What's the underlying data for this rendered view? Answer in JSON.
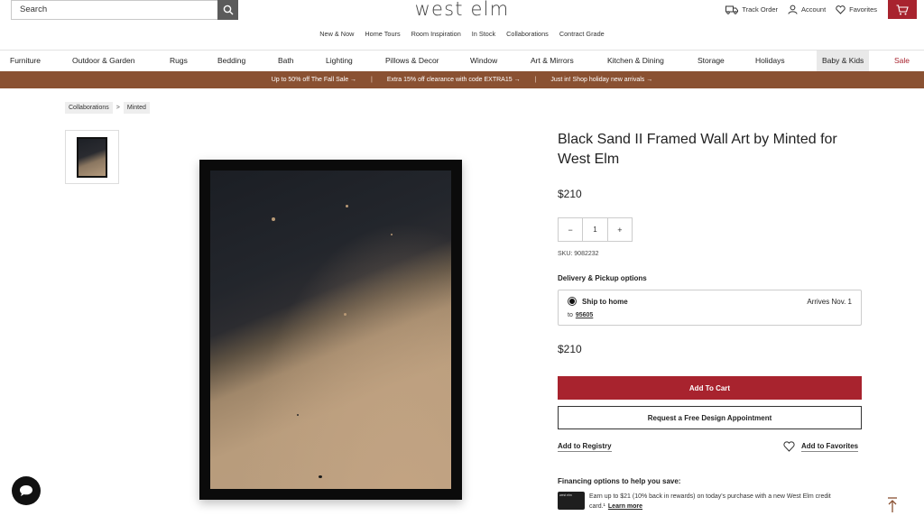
{
  "header": {
    "search_placeholder": "Search",
    "logo": "west elm",
    "subnav": [
      "New & Now",
      "Home Tours",
      "Room Inspiration",
      "In Stock",
      "Collaborations",
      "Contract Grade"
    ],
    "track_order": "Track Order",
    "account": "Account",
    "favorites": "Favorites",
    "accent_color": "#a8232e"
  },
  "nav": {
    "items": [
      "Furniture",
      "Outdoor & Garden",
      "Rugs",
      "Bedding",
      "Bath",
      "Lighting",
      "Pillows & Decor",
      "Window",
      "Art & Mirrors",
      "Kitchen & Dining",
      "Storage",
      "Holidays",
      "Baby & Kids",
      "Sale"
    ]
  },
  "promo": {
    "items": [
      "Up to 50% off The Fall Sale →",
      "Extra 15% off clearance with code EXTRA15 →",
      "Just in! Shop holiday new arrivals →"
    ],
    "separator": "|",
    "color": "#8a5132"
  },
  "breadcrumb": {
    "items": [
      "Collaborations",
      "Minted"
    ],
    "separator": ">"
  },
  "product": {
    "title": "Black Sand II Framed Wall Art by Minted for West Elm",
    "price": "$210",
    "qty_minus": "−",
    "qty_value": "1",
    "qty_plus": "+",
    "sku": "SKU: 9082232",
    "delivery_title": "Delivery & Pickup options",
    "ship_to_home": "Ship to home",
    "arrives": "Arrives Nov. 1",
    "to_label": "to",
    "zip": "95605",
    "price_total": "$210",
    "add_to_cart": "Add To Cart",
    "design_appointment": "Request a Free Design Appointment",
    "add_to_registry": "Add to Registry",
    "add_to_favorites": "Add to Favorites",
    "financing_title": "Financing options to help you save:",
    "financing_text": "Earn up to $21 (10% back in rewards) on today's purchase with a new West Elm credit card.¹",
    "learn_more": "Learn more",
    "card_label": "west elm"
  }
}
